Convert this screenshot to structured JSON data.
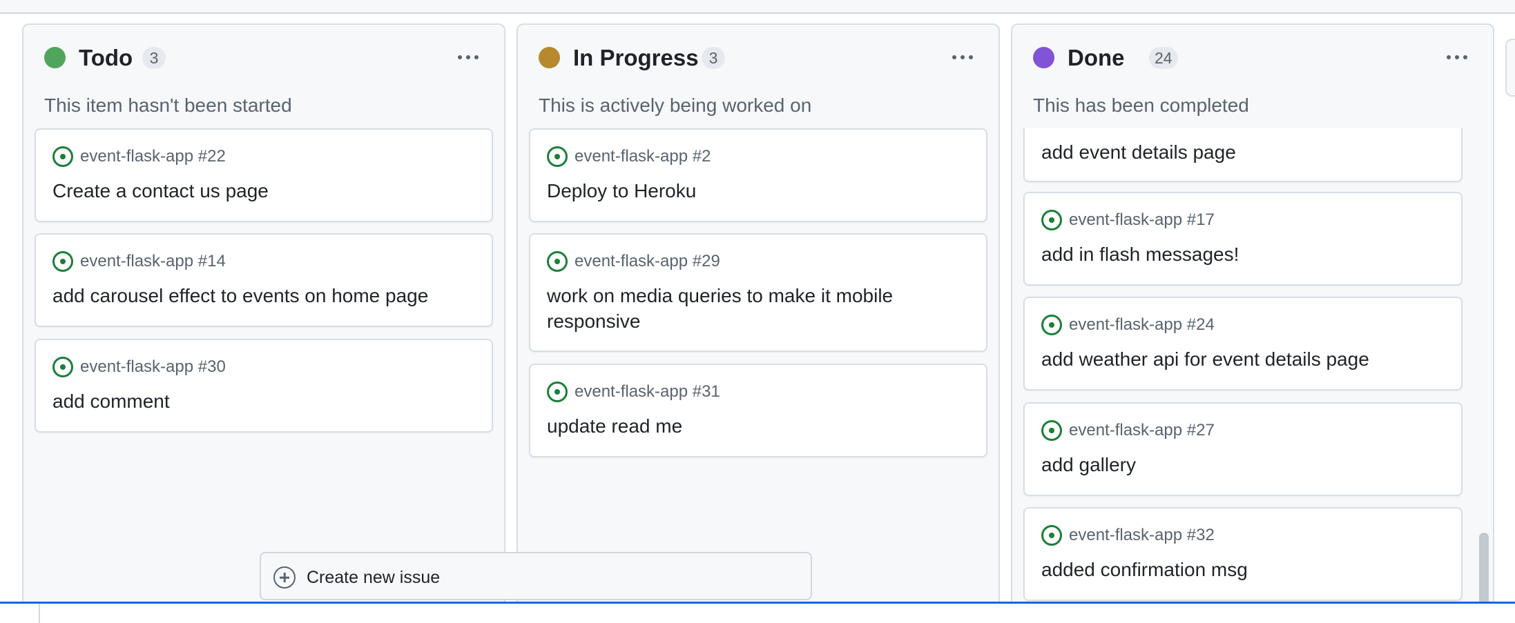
{
  "create_issue": {
    "label": "Create new issue"
  },
  "colors": {
    "todo": "#4fa65a",
    "in_progress": "#b5892c",
    "done": "#8153d6",
    "issue_open": "#1a7f37"
  },
  "columns": [
    {
      "title": "Todo",
      "count": "3",
      "description": "This item hasn't been started",
      "cards": [
        {
          "ref": "event-flask-app #22",
          "title": "Create a contact us page"
        },
        {
          "ref": "event-flask-app #14",
          "title": "add carousel effect to events on home page"
        },
        {
          "ref": "event-flask-app #30",
          "title": "add comment"
        }
      ]
    },
    {
      "title": "In Progress",
      "count": "3",
      "description": "This is actively being worked on",
      "cards": [
        {
          "ref": "event-flask-app #2",
          "title": "Deploy to Heroku"
        },
        {
          "ref": "event-flask-app #29",
          "title": "work on media queries to make it mobile responsive"
        },
        {
          "ref": "event-flask-app #31",
          "title": "update read me"
        }
      ]
    },
    {
      "title": "Done",
      "count": "24",
      "description": "This has been completed",
      "cards": [
        {
          "ref": "",
          "title": "add event details page"
        },
        {
          "ref": "event-flask-app #17",
          "title": "add in flash messages!"
        },
        {
          "ref": "event-flask-app #24",
          "title": "add weather api for event details page"
        },
        {
          "ref": "event-flask-app #27",
          "title": "add gallery"
        },
        {
          "ref": "event-flask-app #32",
          "title": "added confirmation msg"
        }
      ]
    }
  ]
}
